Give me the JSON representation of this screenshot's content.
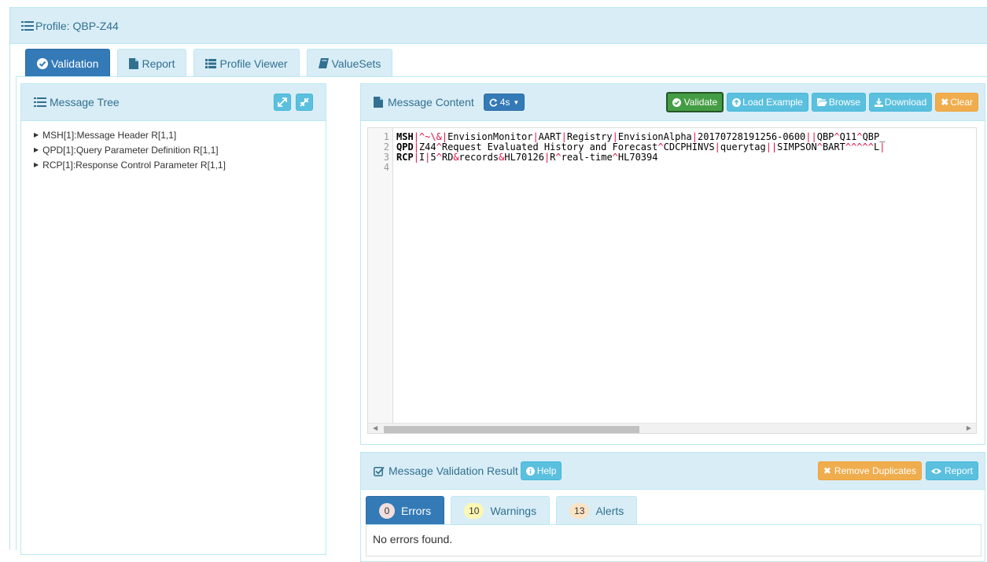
{
  "profile": {
    "title": "Profile: QBP-Z44"
  },
  "tabs": [
    {
      "label": "Validation",
      "icon": "check-circle-icon",
      "active": true
    },
    {
      "label": "Report",
      "icon": "file-icon",
      "active": false
    },
    {
      "label": "Profile Viewer",
      "icon": "list-icon",
      "active": false
    },
    {
      "label": "ValueSets",
      "icon": "book-icon",
      "active": false
    }
  ],
  "message_tree": {
    "title": "Message Tree",
    "items": [
      "MSH[1]:Message Header R[1,1]",
      "QPD[1]:Query Parameter Definition R[1,1]",
      "RCP[1]:Response Control Parameter R[1,1]"
    ]
  },
  "message_content": {
    "title": "Message Content",
    "refresh_label": "4s",
    "buttons": {
      "validate": "Validate",
      "load_example": "Load Example",
      "browse": "Browse",
      "download": "Download",
      "clear": "Clear"
    },
    "line_numbers": [
      "1",
      "2",
      "3",
      "4"
    ],
    "lines": [
      {
        "segment": "MSH",
        "parts": [
          {
            "t": "|",
            "c": "d"
          },
          {
            "t": "^~\\&",
            "c": "d"
          },
          {
            "t": "|",
            "c": "d"
          },
          {
            "t": "EnvisionMonitor",
            "c": "n"
          },
          {
            "t": "|",
            "c": "d"
          },
          {
            "t": "AART",
            "c": "n"
          },
          {
            "t": "|",
            "c": "d"
          },
          {
            "t": "Registry",
            "c": "n"
          },
          {
            "t": "|",
            "c": "d"
          },
          {
            "t": "EnvisionAlpha",
            "c": "n"
          },
          {
            "t": "|",
            "c": "d"
          },
          {
            "t": "20170728191256-0600",
            "c": "n"
          },
          {
            "t": "||",
            "c": "d"
          },
          {
            "t": "QBP",
            "c": "n"
          },
          {
            "t": "^",
            "c": "d"
          },
          {
            "t": "Q11",
            "c": "n"
          },
          {
            "t": "^",
            "c": "d"
          },
          {
            "t": "QBP_",
            "c": "n"
          }
        ]
      },
      {
        "segment": "QPD",
        "parts": [
          {
            "t": "|",
            "c": "d"
          },
          {
            "t": "Z44",
            "c": "n"
          },
          {
            "t": "^",
            "c": "d"
          },
          {
            "t": "Request Evaluated History and Forecast",
            "c": "n"
          },
          {
            "t": "^",
            "c": "d"
          },
          {
            "t": "CDCPHINVS",
            "c": "n"
          },
          {
            "t": "|",
            "c": "d"
          },
          {
            "t": "querytag",
            "c": "n"
          },
          {
            "t": "||",
            "c": "d"
          },
          {
            "t": "SIMPSON",
            "c": "n"
          },
          {
            "t": "^",
            "c": "d"
          },
          {
            "t": "BART",
            "c": "n"
          },
          {
            "t": "^^^^^",
            "c": "d"
          },
          {
            "t": "L",
            "c": "n"
          },
          {
            "t": "|",
            "c": "d"
          }
        ]
      },
      {
        "segment": "RCP",
        "parts": [
          {
            "t": "|",
            "c": "d"
          },
          {
            "t": "I",
            "c": "n"
          },
          {
            "t": "|",
            "c": "d"
          },
          {
            "t": "5",
            "c": "n"
          },
          {
            "t": "^",
            "c": "d"
          },
          {
            "t": "RD",
            "c": "n"
          },
          {
            "t": "&",
            "c": "d"
          },
          {
            "t": "records",
            "c": "n"
          },
          {
            "t": "&",
            "c": "d"
          },
          {
            "t": "HL70126",
            "c": "n"
          },
          {
            "t": "|",
            "c": "d"
          },
          {
            "t": "R",
            "c": "n"
          },
          {
            "t": "^",
            "c": "d"
          },
          {
            "t": "real-time",
            "c": "n"
          },
          {
            "t": "^",
            "c": "d"
          },
          {
            "t": "HL70394",
            "c": "n"
          }
        ]
      },
      {
        "segment": "",
        "parts": []
      }
    ]
  },
  "validation_result": {
    "title": "Message Validation Result",
    "help_label": "Help",
    "remove_duplicates_label": "Remove Duplicates",
    "report_label": "Report",
    "tabs": [
      {
        "count": "0",
        "label": "Errors",
        "badge_color": "#f2dede",
        "active": true
      },
      {
        "count": "10",
        "label": "Warnings",
        "badge_color": "#fcf8b3",
        "active": false
      },
      {
        "count": "13",
        "label": "Alerts",
        "badge_color": "#fbe3c6",
        "active": false
      }
    ],
    "message": "No errors found."
  },
  "colors": {
    "primary": "#337ab7",
    "info_bg": "#d9edf7",
    "info_text": "#31708f",
    "success": "#5cb85c",
    "warning": "#f0ad4e",
    "delimiter": "#dd1144"
  }
}
